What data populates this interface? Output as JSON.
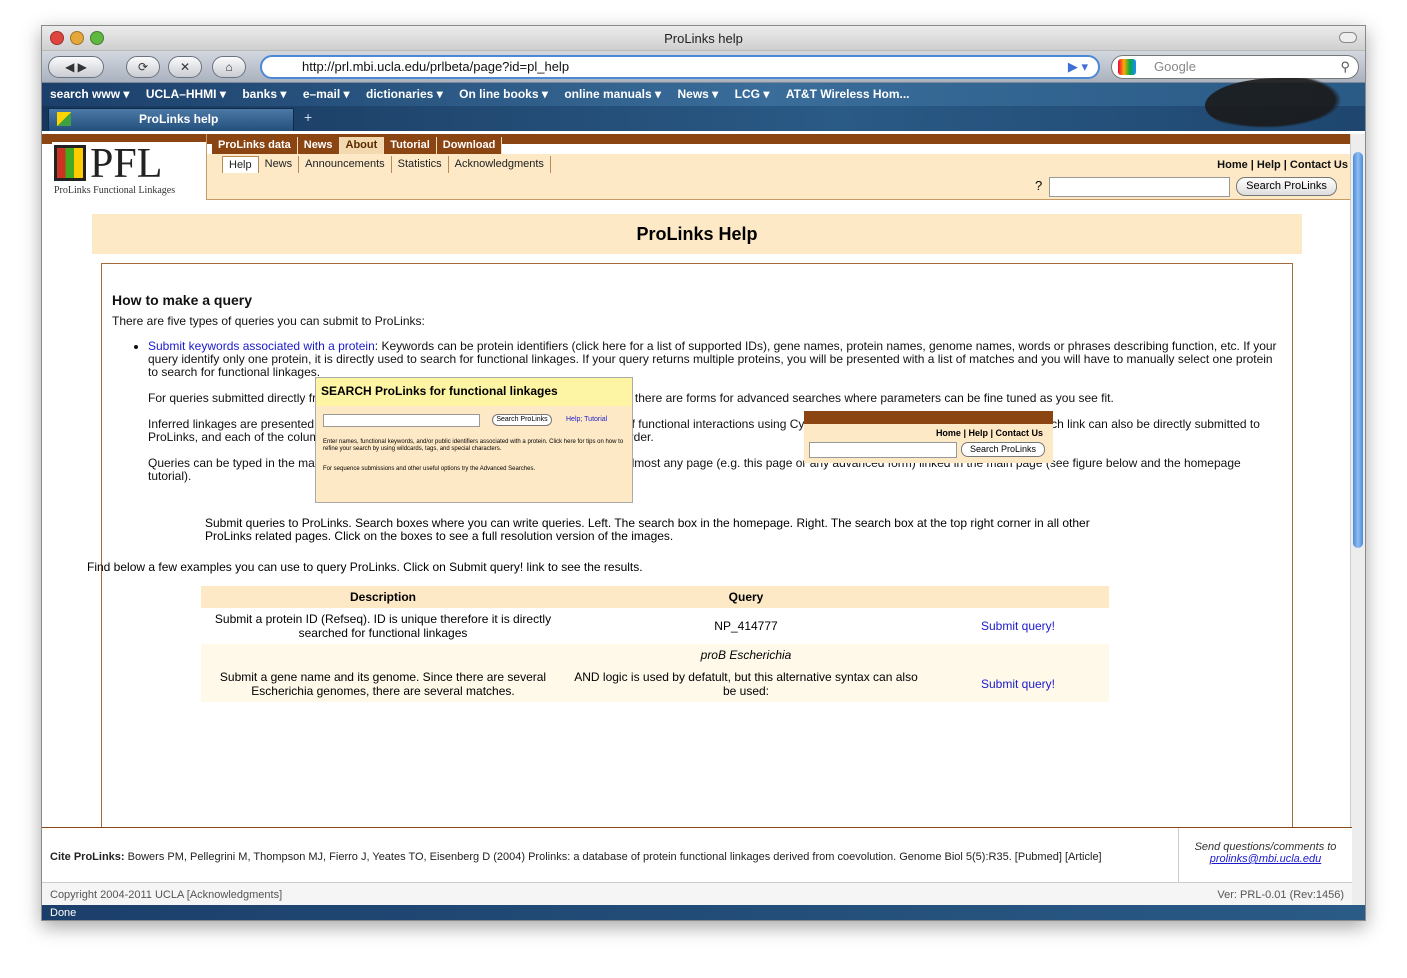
{
  "window": {
    "title": "ProLinks help"
  },
  "toolbar": {
    "url": "http://prl.mbi.ucla.edu/prlbeta/page?id=pl_help",
    "search_placeholder": "Google"
  },
  "bookmarks": [
    "search www ▾",
    "UCLA–HHMI ▾",
    "banks ▾",
    "e–mail ▾",
    "dictionaries ▾",
    "On line books ▾",
    "online manuals ▾",
    "News ▾",
    "LCG ▾",
    "AT&T Wireless Hom..."
  ],
  "tab": {
    "label": "ProLinks help"
  },
  "site": {
    "logo_text": "PFL",
    "logo_sub": "ProLinks Functional Linkages",
    "topnav": [
      "ProLinks data",
      "News",
      "About",
      "Tutorial",
      "Download"
    ],
    "subnav": [
      "Help",
      "News",
      "Announcements",
      "Statistics",
      "Acknowledgments"
    ],
    "links": "Home | Help | Contact Us",
    "qmark": "?",
    "search_btn": "Search ProLinks"
  },
  "page": {
    "title": "ProLinks Help",
    "h2": "How to make a query",
    "intro": "There are five types of queries you can submit to ProLinks:",
    "bullet_link": "Submit keywords associated with a protein",
    "bullet_text": ": Keywords can be protein identifiers (click here for a list of supported IDs), gene names, protein names, genome names, words or phrases describing function, etc. If your query identify only one protein, it is directly used to search for functional linkages. If your query returns multiple proteins, you will be presented with a list of matches and you will have to manually select one protein to search for functional linkages.",
    "p1": "For queries submitted directly from the main page, only default settings are used. However, there are forms for advanced searches where parameters can be fine tuned as you see fit.",
    "p2": "Inferred linkages are presented in a table that also includes a link to visualize the network of functional interactions using Cytoscape (see the tutorial for further details). Each link can also be directly submitted to ProLinks, and each of the columns in the table can be sorted in ascending or descending order.",
    "p3": "Queries can be typed in the main page, or in the text box located in the top right corner of almost any page (e.g. this page or any advanced form) linked in the main page (see figure below and the homepage tutorial).",
    "shot_title": "SEARCH ProLinks for functional linkages",
    "shot_btn": "Search ProLinks",
    "shot_help": "Help; Tutorial",
    "shot_line1": "Enter names, functional keywords, and/or public identifiers associated with a protein. Click here for tips on how to refine your search by using wildcards, tags, and special characters.",
    "shot_line2": "For sequence submissions and other useful options try the Advanced Searches.",
    "shot2_links": "Home | Help | Contact Us",
    "shot2_btn": "Search ProLinks",
    "caption": "Submit queries to ProLinks. Search boxes where you can write queries. Left. The search box in the homepage. Right. The search box at the top right corner in all other ProLinks related pages. Click on the boxes to see a full resolution version of the images.",
    "examples": "Find below a few examples you can use to query ProLinks. Click on Submit query! link to see the results.",
    "table": {
      "headers": [
        "Description",
        "Query",
        ""
      ],
      "rows": [
        [
          "Submit a protein ID (Refseq). ID is unique therefore it is directly searched for functional linkages",
          "NP_414777",
          "Submit query!"
        ],
        [
          "",
          "proB Escherichia",
          ""
        ],
        [
          "Submit a gene name and its genome. Since there are several Escherichia genomes, there are several matches.",
          "AND logic is used by defatult, but this alternative syntax can also be used:",
          "Submit query!"
        ]
      ]
    }
  },
  "footer": {
    "cite_label": "Cite ProLinks:",
    "cite": "Bowers PM, Pellegrini M, Thompson MJ, Fierro J, Yeates TO, Eisenberg D (2004) Prolinks: a database of protein functional linkages derived from coevolution. Genome Biol 5(5):R35. [Pubmed] [Article]",
    "send": "Send questions/comments to",
    "email": "prolinks@mbi.ucla.edu",
    "copyright": "Copyright 2004-2011 UCLA [Acknowledgments]",
    "version": "Ver: PRL-0.01 (Rev:1456)"
  },
  "status": "Done"
}
